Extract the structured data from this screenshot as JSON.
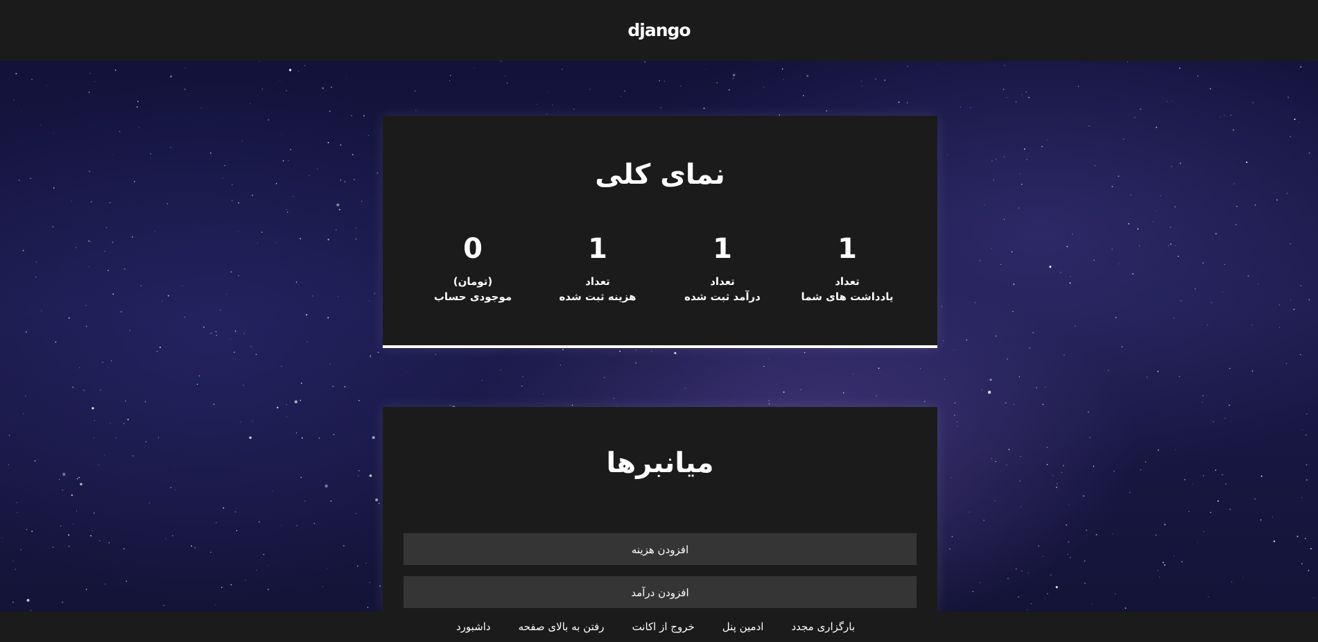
{
  "header": {
    "logo_text": "django"
  },
  "overview": {
    "title": "نمای کلی",
    "stats": [
      {
        "value": "1",
        "line1": "تعداد",
        "line2": "یادداشت های شما"
      },
      {
        "value": "1",
        "line1": "تعداد",
        "line2": "درآمد ثبت شده"
      },
      {
        "value": "1",
        "line1": "تعداد",
        "line2": "هزینه ثبت شده"
      },
      {
        "value": "0",
        "line1": "(تومان)",
        "line2": "موجودی حساب"
      }
    ]
  },
  "shortcuts": {
    "title": "میانبرها",
    "add_expense_label": "افزودن هزینه",
    "add_income_label": "افزودن درآمد"
  },
  "footer": {
    "links": [
      "بارگزاری مجدد",
      "ادمین پنل",
      "خروج از اکانت",
      "رفتن به بالای صفحه",
      "داشبورد"
    ]
  },
  "colors": {
    "bar_bg": "#1b1b1b",
    "card_bg": "#1b1b1b",
    "button_bg": "#353535",
    "accent": "#ffffff"
  }
}
